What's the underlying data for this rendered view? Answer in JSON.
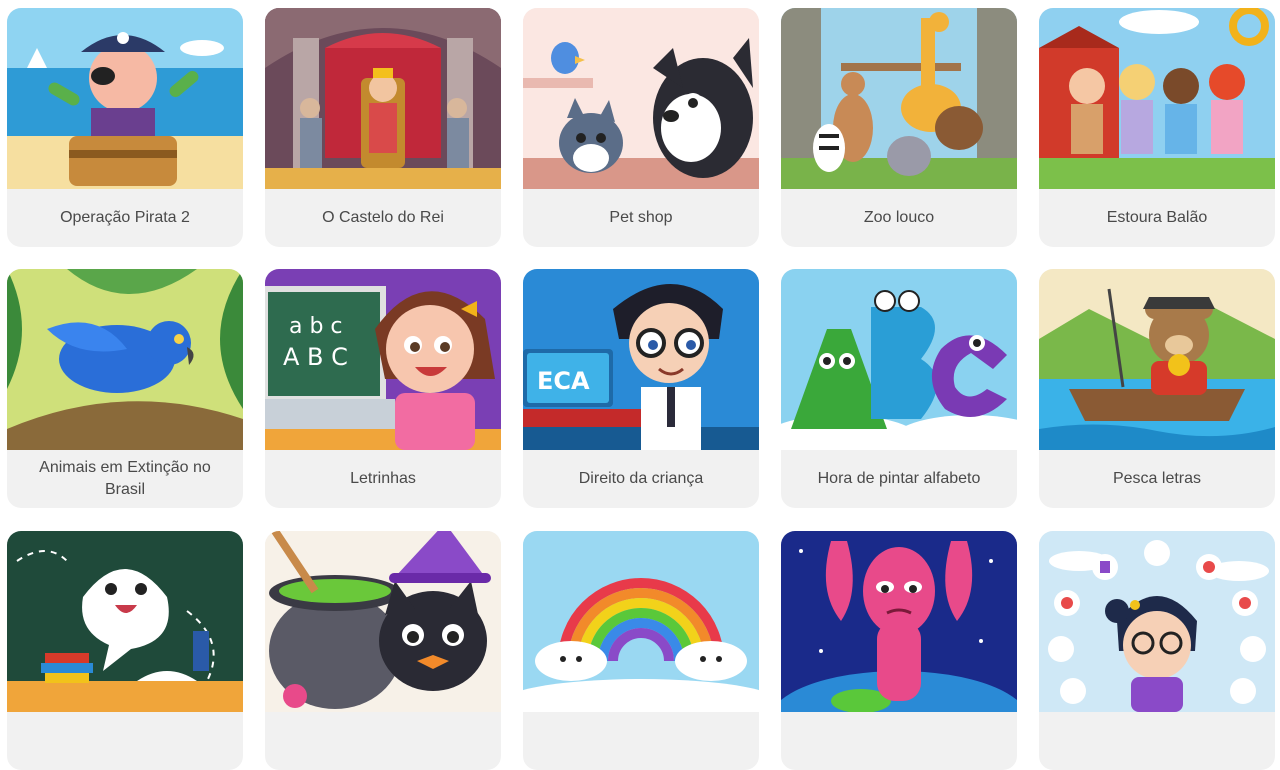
{
  "games": [
    {
      "title": "Operação Pirata 2",
      "thumb": "pirate-thumbnail"
    },
    {
      "title": "O Castelo do Rei",
      "thumb": "castle-thumbnail"
    },
    {
      "title": "Pet shop",
      "thumb": "pet-shop-thumbnail"
    },
    {
      "title": "Zoo louco",
      "thumb": "zoo-thumbnail"
    },
    {
      "title": "Estoura Balão",
      "thumb": "balloon-thumbnail"
    },
    {
      "title": "Animais em Extinção no Brasil",
      "thumb": "macaw-thumbnail"
    },
    {
      "title": "Letrinhas",
      "thumb": "letters-thumbnail"
    },
    {
      "title": "Direito da criança",
      "thumb": "eca-thumbnail"
    },
    {
      "title": "Hora de pintar alfabeto",
      "thumb": "abc-monsters-thumbnail"
    },
    {
      "title": "Pesca letras",
      "thumb": "fishing-bear-thumbnail"
    },
    {
      "title": "",
      "thumb": "speech-bubble-thumbnail"
    },
    {
      "title": "",
      "thumb": "witch-cat-thumbnail"
    },
    {
      "title": "",
      "thumb": "rainbow-thumbnail"
    },
    {
      "title": "",
      "thumb": "pink-alien-thumbnail"
    },
    {
      "title": "",
      "thumb": "girl-icons-thumbnail"
    }
  ],
  "thumbnail_texts": {
    "letters_lower": "a b c",
    "letters_upper": "A B C",
    "eca": "ECA"
  }
}
